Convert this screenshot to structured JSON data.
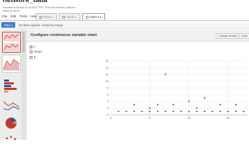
{
  "app": {
    "title": "network_data",
    "import_line": "Imported at Sat Apr 16 16:40:07 PDT 2016 from network_data.csv",
    "edit_line": "Edited at 16:44"
  },
  "menu": [
    "File",
    "Edit",
    "Tools",
    "Help"
  ],
  "tabs": [
    {
      "label": "Rows 1",
      "active": false
    },
    {
      "label": "Cards 1",
      "active": false
    },
    {
      "label": "Chart 1 ▾",
      "active": true
    }
  ],
  "filter": {
    "button_label": "Filter ▾",
    "message": "No filters applied. Sorted by Target"
  },
  "panel": {
    "title": "Configure continuous variable chart",
    "change_button": "Change visualiz...",
    "done_button": "Done"
  },
  "options": [
    {
      "label": "#",
      "checked": true
    },
    {
      "label": "Target",
      "checked": false
    },
    {
      "label": "$",
      "checked": false
    }
  ],
  "chart_data": {
    "type": "scatter",
    "title": "",
    "xlabel": "",
    "ylabel": "",
    "xlim": [
      0,
      17.5
    ],
    "ylim": [
      0,
      16
    ],
    "xticks": [
      0,
      5,
      10,
      15
    ],
    "yticks": [
      0,
      2,
      4,
      6,
      8,
      10,
      12,
      14,
      16
    ],
    "grid": true,
    "color": "#3b5bbf",
    "points": [
      [
        1,
        1
      ],
      [
        2,
        1
      ],
      [
        3,
        1
      ],
      [
        3,
        3
      ],
      [
        4,
        1
      ],
      [
        5,
        1
      ],
      [
        5,
        2
      ],
      [
        6,
        1
      ],
      [
        6,
        3
      ],
      [
        7,
        1
      ],
      [
        7,
        12
      ],
      [
        8,
        1
      ],
      [
        8,
        3
      ],
      [
        9,
        1
      ],
      [
        10,
        4
      ],
      [
        10,
        1
      ],
      [
        11,
        1
      ],
      [
        11,
        2
      ],
      [
        12,
        5
      ],
      [
        12,
        1
      ],
      [
        13,
        1
      ],
      [
        14,
        1
      ],
      [
        14,
        3
      ],
      [
        15,
        1
      ],
      [
        16,
        3
      ],
      [
        16,
        1
      ],
      [
        17,
        1
      ]
    ]
  }
}
